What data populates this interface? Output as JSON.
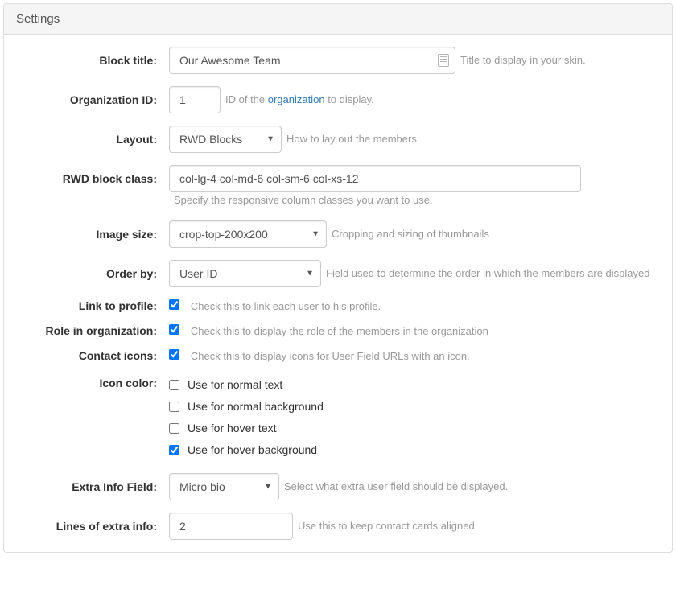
{
  "panel_title": "Settings",
  "fields": {
    "block_title": {
      "label": "Block title:",
      "value": "Our Awesome Team",
      "help": "Title to display in your skin."
    },
    "org_id": {
      "label": "Organization ID:",
      "value": "1",
      "help_before": "ID of the ",
      "help_link": "organization",
      "help_after": " to display."
    },
    "layout": {
      "label": "Layout:",
      "value": "RWD Blocks",
      "help": "How to lay out the members"
    },
    "rwd_class": {
      "label": "RWD block class:",
      "value": "col-lg-4 col-md-6 col-sm-6 col-xs-12",
      "help": "Specify the responsive column classes you want to use."
    },
    "image_size": {
      "label": "Image size:",
      "value": "crop-top-200x200",
      "help": "Cropping and sizing of thumbnails"
    },
    "order_by": {
      "label": "Order by:",
      "value": "User ID",
      "help": "Field used to determine the order in which the members are displayed"
    },
    "link_profile": {
      "label": "Link to profile:",
      "checked": true,
      "help": "Check this to link each user to his profile."
    },
    "role": {
      "label": "Role in organization:",
      "checked": true,
      "help": "Check this to display the role of the members in the organization"
    },
    "contact_icons": {
      "label": "Contact icons:",
      "checked": true,
      "help": "Check this to display icons for User Field URLs with an icon."
    },
    "icon_color": {
      "label": "Icon color:",
      "options": [
        {
          "label": "Use for normal text",
          "checked": false
        },
        {
          "label": "Use for normal background",
          "checked": false
        },
        {
          "label": "Use for hover text",
          "checked": false
        },
        {
          "label": "Use for hover background",
          "checked": true
        }
      ]
    },
    "extra_info": {
      "label": "Extra Info Field:",
      "value": "Micro bio",
      "help": "Select what extra user field should be displayed."
    },
    "lines": {
      "label": "Lines of extra info:",
      "value": "2",
      "help": "Use this to keep contact cards aligned."
    }
  }
}
